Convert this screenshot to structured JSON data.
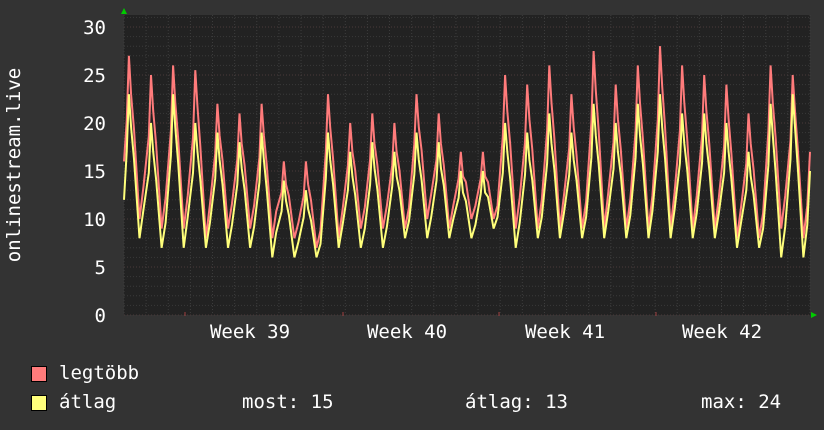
{
  "chart_data": {
    "type": "line",
    "title": "",
    "ylabel": "onlinestream.live",
    "xlabel": "",
    "ylim": [
      0,
      31.25
    ],
    "yticks": [
      "0",
      "5",
      "10",
      "15",
      "20",
      "25",
      "30"
    ],
    "xtick_labels": [
      "Week 39",
      "Week 40",
      "Week 41",
      "Week 42"
    ],
    "days": 31,
    "grid": true,
    "series": [
      {
        "name": "legtöbb",
        "color": "#ff7b7b",
        "start": 16,
        "peaks": [
          27,
          25,
          26,
          25.5,
          22,
          21,
          22,
          16,
          16,
          23,
          20,
          21,
          20,
          23,
          21,
          17,
          17,
          25,
          24,
          26,
          23,
          27.5,
          24,
          26,
          28,
          26,
          25,
          24,
          21,
          26,
          25
        ],
        "troughs": [
          10,
          9,
          9,
          8,
          9,
          9,
          8,
          8,
          7,
          8,
          9,
          9,
          9,
          10,
          9,
          10,
          10,
          9,
          9,
          9,
          9,
          9,
          9,
          9,
          9,
          9,
          9,
          8,
          8,
          9,
          8
        ],
        "end": 17
      },
      {
        "name": "átlag",
        "color": "#ffff7b",
        "start": 12,
        "peaks": [
          23,
          20,
          23,
          20,
          19,
          18,
          19,
          14,
          13,
          19,
          17,
          18,
          17,
          19,
          18,
          15,
          15,
          20,
          19,
          21,
          19,
          22,
          20,
          22,
          23,
          21,
          21,
          20,
          17,
          22,
          23
        ],
        "troughs": [
          8,
          7,
          7,
          7,
          7,
          7,
          6,
          6,
          6,
          7,
          7,
          7,
          8,
          8,
          8,
          8,
          9,
          7,
          8,
          8,
          8,
          8,
          8,
          8,
          8,
          8,
          8,
          7,
          7,
          6,
          6
        ],
        "end": 15
      }
    ]
  },
  "legend": {
    "max_label": "legtöbb",
    "avg_label": "átlag",
    "now": "most: 15",
    "avg": "átlag: 13",
    "max": "max: 24"
  },
  "colors": {
    "max": "#ff7b7b",
    "avg": "#ffff7b",
    "background": "#333333",
    "canvas": "#222222"
  }
}
